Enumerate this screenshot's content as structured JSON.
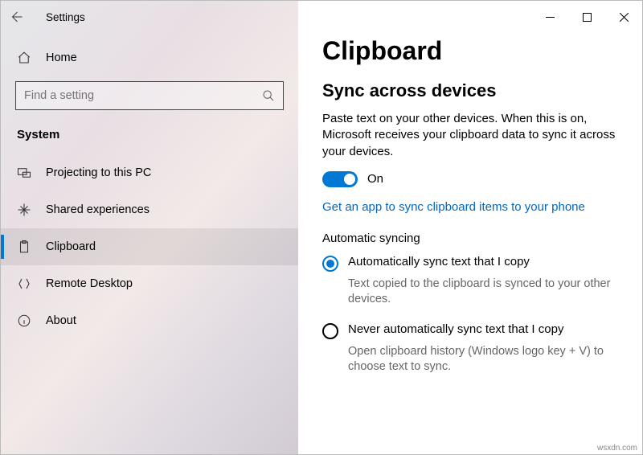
{
  "titlebar": {
    "title": "Settings"
  },
  "sidebar": {
    "home": "Home",
    "search_placeholder": "Find a setting",
    "section": "System",
    "items": [
      {
        "label": "Projecting to this PC"
      },
      {
        "label": "Shared experiences"
      },
      {
        "label": "Clipboard"
      },
      {
        "label": "Remote Desktop"
      },
      {
        "label": "About"
      }
    ]
  },
  "main": {
    "title": "Clipboard",
    "section_title": "Sync across devices",
    "description": "Paste text on your other devices. When this is on, Microsoft receives your clipboard data to sync it across your devices.",
    "toggle_state": "On",
    "link": "Get an app to sync clipboard items to your phone",
    "auto_heading": "Automatic syncing",
    "options": [
      {
        "label": "Automatically sync text that I copy",
        "desc": "Text copied to the clipboard is synced to your other devices."
      },
      {
        "label": "Never automatically sync text that I copy",
        "desc": "Open clipboard history (Windows logo key + V) to choose text to sync."
      }
    ]
  },
  "watermark": "wsxdn.com"
}
